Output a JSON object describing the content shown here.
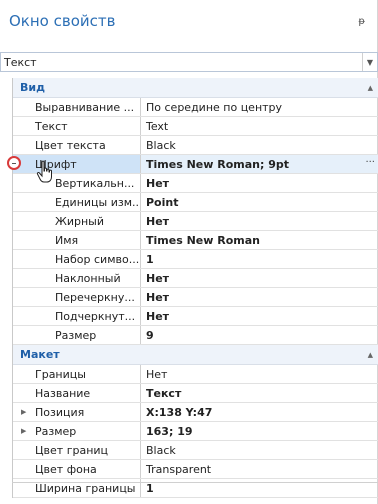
{
  "window": {
    "title": "Окно свойств",
    "pin_icon": "ᵽ"
  },
  "selector": {
    "value": "Текст"
  },
  "categories": [
    {
      "name": "Вид",
      "rows": [
        {
          "key": "Выравнивание ...",
          "value": "По середине по центру",
          "bold": false
        },
        {
          "key": "Текст",
          "value": "Text",
          "bold": false
        },
        {
          "key": "Цвет текста",
          "value": "Black",
          "bold": false
        },
        {
          "key": "Шрифт",
          "value": "Times New Roman; 9pt",
          "bold": true,
          "selected": true,
          "expanded": true
        },
        {
          "key": "Вертикальн...",
          "value": "Нет",
          "bold": true,
          "sub": true
        },
        {
          "key": "Единицы изм...",
          "value": "Point",
          "bold": true,
          "sub": true
        },
        {
          "key": "Жирный",
          "value": "Нет",
          "bold": true,
          "sub": true
        },
        {
          "key": "Имя",
          "value": "Times New Roman",
          "bold": true,
          "sub": true
        },
        {
          "key": "Набор симво...",
          "value": "1",
          "bold": true,
          "sub": true
        },
        {
          "key": "Наклонный",
          "value": "Нет",
          "bold": true,
          "sub": true
        },
        {
          "key": "Перечеркну...",
          "value": "Нет",
          "bold": true,
          "sub": true
        },
        {
          "key": "Подчеркнут...",
          "value": "Нет",
          "bold": true,
          "sub": true
        },
        {
          "key": "Размер",
          "value": "9",
          "bold": true,
          "sub": true
        }
      ]
    },
    {
      "name": "Макет",
      "rows": [
        {
          "key": "Границы",
          "value": "Нет",
          "bold": false
        },
        {
          "key": "Название",
          "value": "Текст",
          "bold": true
        },
        {
          "key": "Позиция",
          "value": "X:138 Y:47",
          "bold": true,
          "expandable": true
        },
        {
          "key": "Размер",
          "value": "163; 19",
          "bold": true,
          "expandable": true
        },
        {
          "key": "Цвет границ",
          "value": "Black",
          "bold": false
        },
        {
          "key": "Цвет фона",
          "value": "Transparent",
          "bold": false
        },
        {
          "key": "Ширина границы",
          "value": "1",
          "bold": true
        }
      ]
    }
  ]
}
